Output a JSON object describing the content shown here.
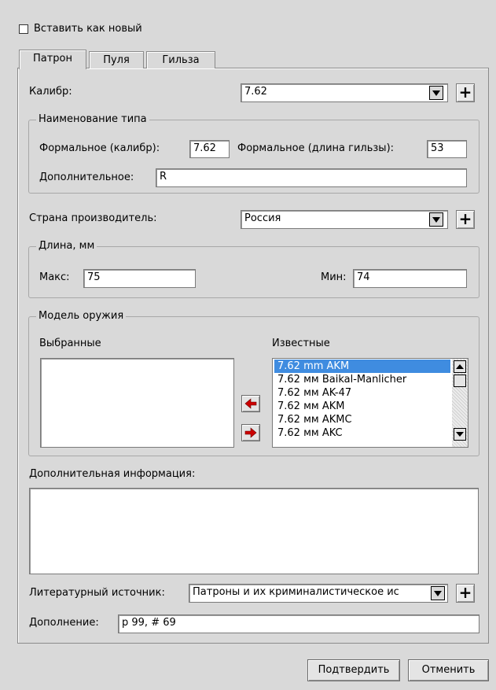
{
  "insert_as_new": {
    "label": "Вставить как новый",
    "checked": false
  },
  "tabs": [
    {
      "label": "Патрон",
      "active": true
    },
    {
      "label": "Пуля",
      "active": false
    },
    {
      "label": "Гильза",
      "active": false
    }
  ],
  "caliber": {
    "label": "Калибр:",
    "value": "7.62"
  },
  "type_name": {
    "title": "Наименование типа",
    "formal_caliber_label": "Формальное (калибр):",
    "formal_caliber_value": "7.62",
    "formal_length_label": "Формальное (длина гильзы):",
    "formal_length_value": "53",
    "additional_label": "Дополнительное:",
    "additional_value": "R"
  },
  "country": {
    "label": "Страна производитель:",
    "value": "Россия"
  },
  "length": {
    "title": "Длина, мм",
    "max_label": "Макс:",
    "max_value": "75",
    "min_label": "Мин:",
    "min_value": "74"
  },
  "weapon_model": {
    "title": "Модель оружия",
    "selected_label": "Выбранные",
    "known_label": "Известные",
    "known_items": [
      "7.62 mm AKM",
      "7.62 мм Baikal-Manlicher",
      "7.62 мм AK-47",
      "7.62 мм AKM",
      "7.62 мм AKMC",
      "7.62 мм AKC"
    ]
  },
  "additional_info": {
    "label": "Дополнительная информация:",
    "value": ""
  },
  "literature": {
    "label": "Литературный источник:",
    "value": "Патроны и их криминалистическое ис"
  },
  "supplement": {
    "label": "Дополнение:",
    "value": "p 99, # 69"
  },
  "buttons": {
    "confirm": "Подтвердить",
    "cancel": "Отменить"
  },
  "colors": {
    "background": "#d9d9d9",
    "selection": "#3f8ce0",
    "arrow": "#cc0000"
  }
}
